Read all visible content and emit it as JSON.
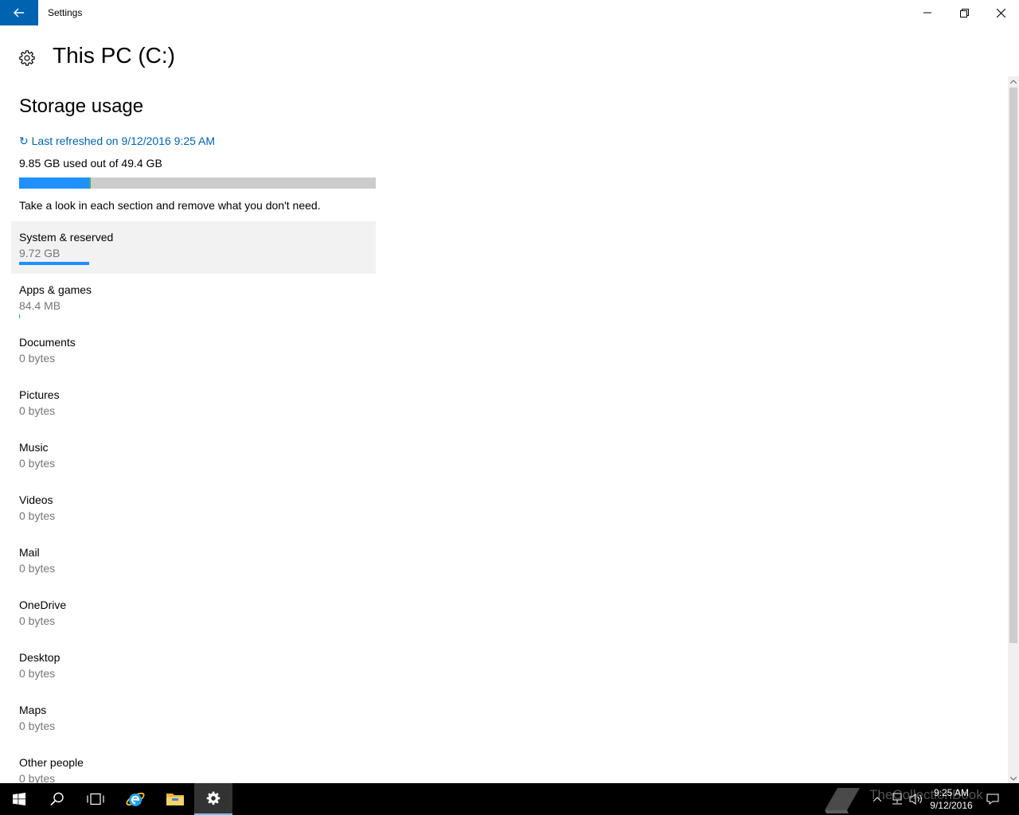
{
  "window": {
    "title": "Settings",
    "minimize_glyph": "—",
    "restore_glyph": "❐",
    "close_glyph": "✕"
  },
  "header": {
    "title": "This PC (C:)",
    "icon": "gear-icon"
  },
  "storage": {
    "section_title": "Storage usage",
    "refresh_label": "↻ Last refreshed on 9/12/2016 9:25 AM",
    "used_label": "9.85 GB used out of 49.4 GB",
    "used_fraction": 0.199,
    "hint": "Take a look in each section and remove what you don't need.",
    "accent_color": "#1e90ff",
    "secondary_color": "#3cb371"
  },
  "categories": [
    {
      "name": "System & reserved",
      "size": "9.72 GB",
      "fraction": 0.197,
      "bar": "blue",
      "selected": true
    },
    {
      "name": "Apps & games",
      "size": "84.4 MB",
      "fraction": 0.002,
      "bar": "green"
    },
    {
      "name": "Documents",
      "size": "0 bytes"
    },
    {
      "name": "Pictures",
      "size": "0 bytes"
    },
    {
      "name": "Music",
      "size": "0 bytes"
    },
    {
      "name": "Videos",
      "size": "0 bytes"
    },
    {
      "name": "Mail",
      "size": "0 bytes"
    },
    {
      "name": "OneDrive",
      "size": "0 bytes"
    },
    {
      "name": "Desktop",
      "size": "0 bytes"
    },
    {
      "name": "Maps",
      "size": "0 bytes"
    },
    {
      "name": "Other people",
      "size": "0 bytes"
    }
  ],
  "taskbar": {
    "time": "9:25 AM",
    "date": "9/12/2016",
    "watermark": "TheCollectionBook"
  }
}
